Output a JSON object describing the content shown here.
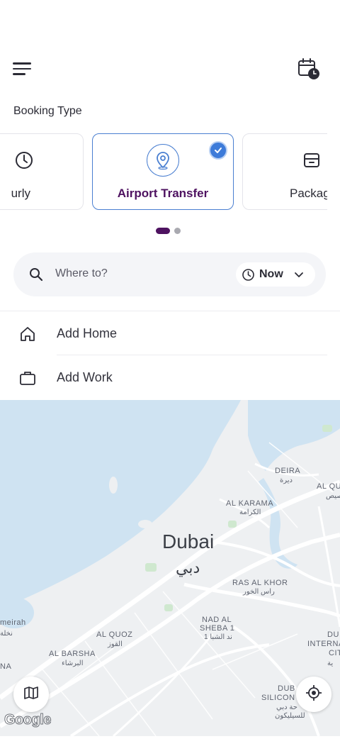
{
  "header": {
    "menu_icon": "hamburger-menu-icon",
    "history_icon": "calendar-clock-icon"
  },
  "booking": {
    "title": "Booking Type",
    "cards": [
      {
        "label": "urly",
        "icon": "clock-icon",
        "selected": false
      },
      {
        "label": "Airport Transfer",
        "icon": "location-pin-icon",
        "selected": true
      },
      {
        "label": "Packag",
        "icon": "package-icon",
        "selected": false
      }
    ],
    "page_count": 2,
    "active_page": 1
  },
  "search": {
    "placeholder": "Where to?",
    "when_label": "Now"
  },
  "saved_places": [
    {
      "label": "Add Home",
      "icon": "home-icon"
    },
    {
      "label": "Add Work",
      "icon": "briefcase-icon"
    }
  ],
  "map": {
    "city_en": "Dubai",
    "city_ar": "دبي",
    "labels": [
      {
        "en": "DEIRA",
        "ar": "ديرة"
      },
      {
        "en": "AL QU",
        "ar": "صيص"
      },
      {
        "en": "AL KARAMA",
        "ar": "الكرامة"
      },
      {
        "en": "RAS AL KHOR",
        "ar": "راس الخور"
      },
      {
        "en": "NAD AL",
        "ar": ""
      },
      {
        "en": "SHEBA 1",
        "ar": "ند الشبا 1"
      },
      {
        "en": "AL QUOZ",
        "ar": "القوز"
      },
      {
        "en": "AL BARSHA",
        "ar": "البرشاء"
      },
      {
        "en": "meirah",
        "ar": "نخلة"
      },
      {
        "en": "NA",
        "ar": ""
      },
      {
        "en": "DU",
        "ar": ""
      },
      {
        "en": "INTERNA",
        "ar": ""
      },
      {
        "en": "CIT",
        "ar": "ية"
      },
      {
        "en": "DUB",
        "ar": ""
      },
      {
        "en": "SILICON",
        "ar": ""
      },
      {
        "en": "",
        "ar": "حة دبي"
      },
      {
        "en": "",
        "ar": "للسيليكون"
      }
    ],
    "attribution": "Google",
    "colors": {
      "water": "#cfe3f2",
      "land": "#eef0f2",
      "road": "#ffffff",
      "park": "#cfe8cf"
    }
  },
  "colors": {
    "brand": "#4e1260",
    "accent": "#3d7bd9"
  }
}
